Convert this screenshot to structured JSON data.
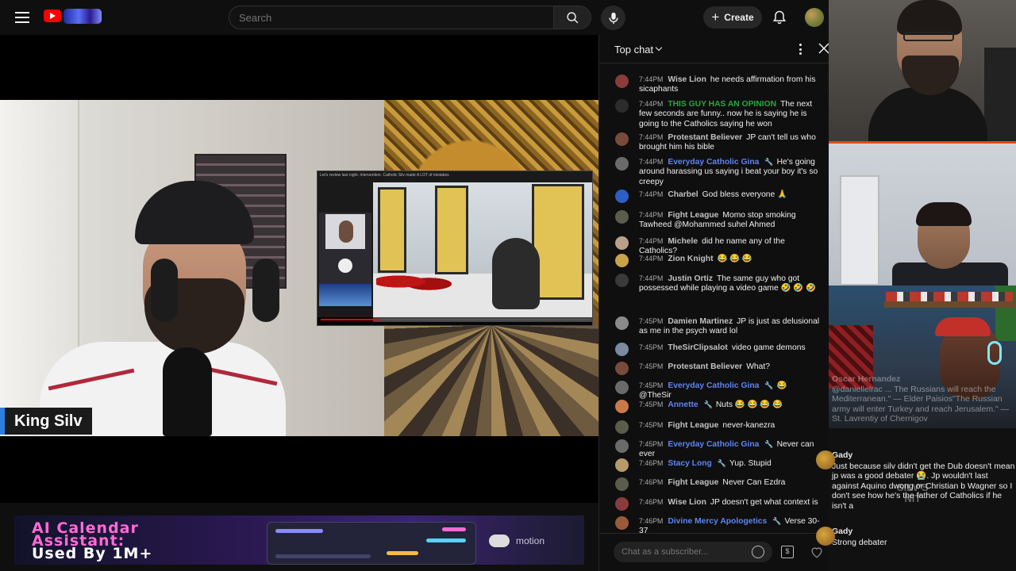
{
  "header": {
    "search_placeholder": "Search",
    "create_label": "Create"
  },
  "video": {
    "streamer_name": "King Silv",
    "inset_title": "Let's review last night. Intervention. Catholic Silv made A LOT of mistakes",
    "inset_progress": 0.22
  },
  "ad": {
    "line1": "AI Calendar",
    "line2": "Assistant:",
    "line3": "Used By 1M+",
    "brand": "motion"
  },
  "chat": {
    "title": "Top chat",
    "input_placeholder": "Chat as a subscriber...",
    "messages": [
      {
        "time": "7:44 PM",
        "author": "Wise Lion",
        "role": "normal",
        "text": "he needs affirmation from his sicaphants",
        "avatar": "#8a3b3b"
      },
      {
        "time": "7:44 PM",
        "author": "THIS GUY HAS AN OPINION",
        "role": "member",
        "text": "The next few seconds are funny.. now he is saying he is going to the Catholics saying he won",
        "avatar": "#2c2c2c"
      },
      {
        "time": "7:44 PM",
        "author": "Protestant Believer",
        "role": "normal",
        "text": "JP can't tell us who brought him his bible",
        "avatar": "#7a4a3a"
      },
      {
        "time": "7:44 PM",
        "author": "Everyday Catholic Gina",
        "role": "mod",
        "text": "He's going around harassing us saying i beat your boy it's so creepy",
        "avatar": "#6a6a6a"
      },
      {
        "time": "7:44 PM",
        "author": "Charbel",
        "role": "normal",
        "text": "God bless everyone 🙏",
        "avatar": "#2c5ec4"
      },
      {
        "time": "7:44 PM",
        "author": "Fight League",
        "role": "normal",
        "text": "Momo stop smoking Tawheed @Mohammed suhel Ahmed",
        "avatar": "#5c5c4a"
      },
      {
        "time": "7:44 PM",
        "author": "Michele",
        "role": "normal",
        "text": "did he name any of the Catholics?",
        "avatar": "#b8a08a"
      },
      {
        "time": "7:44 PM",
        "author": "Zion Knight",
        "role": "normal",
        "text": "😂 😂 😂",
        "avatar": "#c9a24a"
      },
      {
        "time": "7:44 PM",
        "author": "Justin Ortiz",
        "role": "normal",
        "text": "The same guy who got possessed while playing a video game 🤣 🤣 🤣",
        "avatar": "#3a3a3a"
      },
      {
        "time": "7:45 PM",
        "author": "Damien Martinez",
        "role": "normal",
        "text": "JP is just as delusional as me in the psych ward lol",
        "avatar": "#8a8a8a"
      },
      {
        "time": "7:45 PM",
        "author": "TheSirClipsalot",
        "role": "normal",
        "text": "video game demons",
        "avatar": "#7a8aa0"
      },
      {
        "time": "7:45 PM",
        "author": "Protestant Believer",
        "role": "normal",
        "text": "What?",
        "avatar": "#7a4a3a"
      },
      {
        "time": "7:45 PM",
        "author": "Everyday Catholic Gina",
        "role": "mod",
        "text": "😂 @TheSir",
        "avatar": "#6a6a6a"
      },
      {
        "time": "7:45 PM",
        "author": "Annette",
        "role": "mod",
        "text": "Nuts 😂 😂 😂 😂",
        "avatar": "#c97a4a"
      },
      {
        "time": "7:45 PM",
        "author": "Fight League",
        "role": "normal",
        "text": "never-kanezra",
        "avatar": "#5c5c4a"
      },
      {
        "time": "7:45 PM",
        "author": "Everyday Catholic Gina",
        "role": "mod",
        "text": "Never can ever",
        "avatar": "#6a6a6a"
      },
      {
        "time": "7:46 PM",
        "author": "Stacy Long",
        "role": "mod",
        "text": "Yup. Stupid",
        "avatar": "#b89a6a"
      },
      {
        "time": "7:46 PM",
        "author": "Fight League",
        "role": "normal",
        "text": "Never Can Ezdra",
        "avatar": "#5c5c4a"
      },
      {
        "time": "7:46 PM",
        "author": "Wise Lion",
        "role": "normal",
        "text": "JP doesn't get what context is",
        "avatar": "#8a3b3b"
      },
      {
        "time": "7:46 PM",
        "author": "Divine Mercy Apologetics",
        "role": "mod",
        "text": "Verse 30-37",
        "avatar": "#9a5a3a"
      }
    ]
  },
  "side_overlay": {
    "ghost_name": "Oscar Hernandez",
    "ghost_text": "@daniellelrac ... The Russians will reach the Mediterranean.\" — Elder Paisios\"The Russian army will enter Turkey and reach Jerusalem.\" — St. Lavrentiy of Chernigov",
    "messages": [
      {
        "author": "Gady",
        "text": "Just because silv didn't get the Dub doesn't mean jp was a good debater 😭. Jp wouldn't last against Aquino dwong or Christian b Wagner so I don't see how he's the father of Catholics if he isn't a"
      },
      {
        "author": "Gady",
        "text": "Strong debater"
      }
    ],
    "watermark": "SILV'S\nNIT"
  },
  "colors": {
    "member_green": "#2ba640",
    "moderator_blue": "#5e84f1",
    "brand_red": "#ff0000",
    "name_accent": "#2f7de1"
  }
}
